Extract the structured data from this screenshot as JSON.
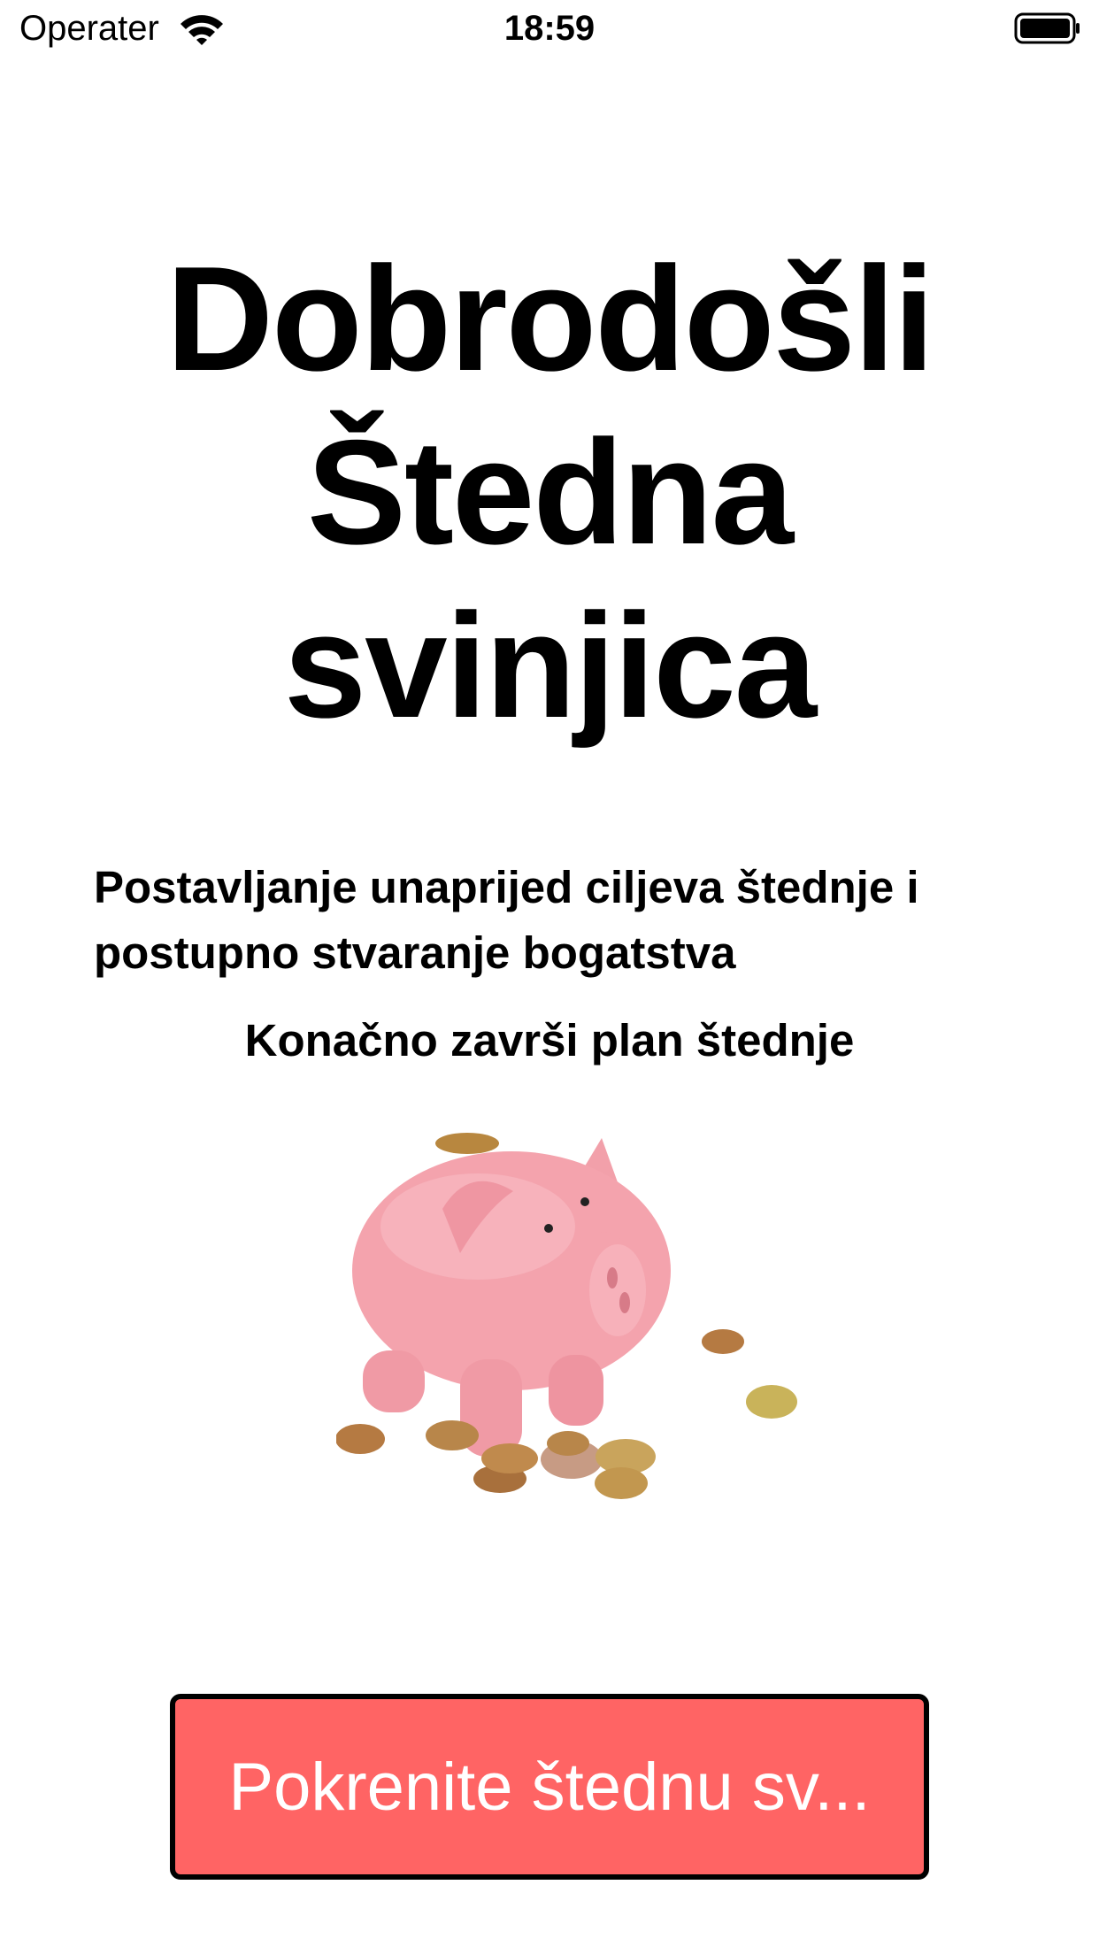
{
  "status_bar": {
    "carrier": "Operater",
    "time": "18:59",
    "icons": [
      "wifi-icon",
      "battery-icon"
    ]
  },
  "welcome": {
    "title_lines": [
      "Dobrodošli",
      "Štedna",
      "svinjica"
    ],
    "subtitle": "Postavljanje unaprijed ciljeva štednje i postupno stvaranje bogatstva",
    "tagline": "Konačno završi plan štednje"
  },
  "illustration": {
    "icon": "piggy-bank-with-coins-icon"
  },
  "actions": {
    "start_label": "Pokrenite štednu sv..."
  },
  "colors": {
    "button_background": "#ff6464",
    "button_text": "#ffffff",
    "button_border": "#000000",
    "piggy_pink": "#f4a3ad",
    "coin_gold": "#c9a45c"
  }
}
